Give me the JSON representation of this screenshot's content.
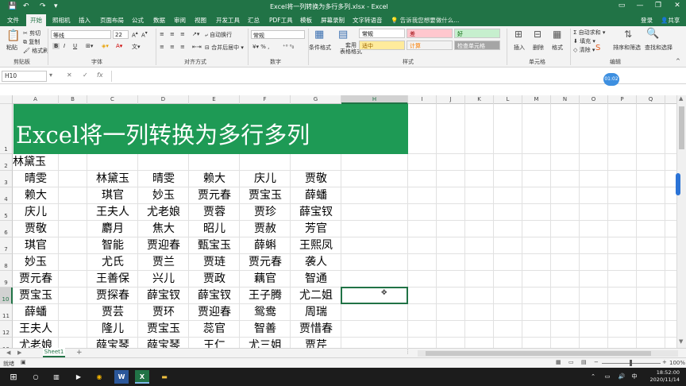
{
  "window": {
    "title": "Excel将一列转换为多行多列.xlsx  -  Excel"
  },
  "menu": {
    "tabs": [
      "文件",
      "开始",
      "照相机",
      "插入",
      "页面布局",
      "公式",
      "数据",
      "审阅",
      "视图",
      "开发工具",
      "汇总",
      "PDF工具",
      "模板",
      "屏幕录制",
      "文字转语音"
    ],
    "active_tab": "开始",
    "tell_me": "告诉我您想要做什么...",
    "login": "登录",
    "share": "共享"
  },
  "ribbon": {
    "clipboard": {
      "paste": "粘贴",
      "cut": "剪切",
      "copy": "复制",
      "format_painter": "格式刷",
      "label": "剪贴板"
    },
    "font": {
      "name": "等线",
      "size": "22",
      "bold": "B",
      "italic": "I",
      "underline": "U",
      "label": "字体"
    },
    "alignment": {
      "wrap": "自动换行",
      "merge": "合并后居中",
      "label": "对齐方式"
    },
    "number": {
      "format": "常规",
      "label": "数字"
    },
    "styles": {
      "conditional": "条件格式",
      "table": "套用\n表格格式",
      "cells": [
        {
          "name": "常规",
          "bg": "#ffffff",
          "fg": "#000000"
        },
        {
          "name": "差",
          "bg": "#ffc7ce",
          "fg": "#9c0006"
        },
        {
          "name": "好",
          "bg": "#c6efce",
          "fg": "#006100"
        },
        {
          "name": "适中",
          "bg": "#ffeb9c",
          "fg": "#9c6500"
        },
        {
          "name": "计算",
          "bg": "#f2f2f2",
          "fg": "#fa7d00"
        },
        {
          "name": "检查单元格",
          "bg": "#a5a5a5",
          "fg": "#ffffff"
        }
      ],
      "label": "样式"
    },
    "cells_group": {
      "insert": "插入",
      "delete": "删除",
      "format": "格式",
      "label": "单元格"
    },
    "editing": {
      "autosum": "自动求和",
      "fill": "填充",
      "clear": "清除",
      "sort": "排序和筛选",
      "find": "查找和选择",
      "label": "编辑"
    }
  },
  "formula_bar": {
    "name_box": "H10",
    "fx": "fx",
    "cancel": "✕",
    "enter": "✓"
  },
  "badge": "01:02",
  "grid": {
    "columns": [
      "A",
      "B",
      "C",
      "D",
      "E",
      "F",
      "G",
      "H",
      "I",
      "J",
      "K",
      "L",
      "M",
      "N",
      "O",
      "P",
      "Q"
    ],
    "rows": [
      "1",
      "2",
      "3",
      "4",
      "5",
      "6",
      "7",
      "8",
      "9",
      "10",
      "11",
      "12",
      "13"
    ],
    "banner": "Excel将一列转换为多行多列",
    "colA": [
      "林黛玉",
      "晴雯",
      "赖大",
      "庆儿",
      "贾敬",
      "琪官",
      "妙玉",
      "贾元春",
      "贾宝玉",
      "薛蟠",
      "王夫人",
      "尤老娘"
    ],
    "table": [
      [
        "林黛玉",
        "晴雯",
        "赖大",
        "庆儿",
        "贾敬"
      ],
      [
        "琪官",
        "妙玉",
        "贾元春",
        "贾宝玉",
        "薛蟠"
      ],
      [
        "王夫人",
        "尤老娘",
        "贾蓉",
        "贾珍",
        "薛宝钗"
      ],
      [
        "麝月",
        "焦大",
        "昭儿",
        "贾赦",
        "芳官"
      ],
      [
        "智能",
        "贾迎春",
        "甄宝玉",
        "薛蝌",
        "王熙凤"
      ],
      [
        "尤氏",
        "贾兰",
        "贾琏",
        "贾元春",
        "袭人"
      ],
      [
        "王善保",
        "兴儿",
        "贾政",
        "藕官",
        "智通"
      ],
      [
        "贾探春",
        "薛宝钗",
        "薛宝钗",
        "王子腾",
        "尤二姐"
      ],
      [
        "贾芸",
        "贾环",
        "贾迎春",
        "鸳鸯",
        "周瑞"
      ],
      [
        "隆儿",
        "贾宝玉",
        "蕊官",
        "智善",
        "贾惜春"
      ],
      [
        "薛宝琴",
        "薛宝琴",
        "王仁",
        "尤三姐",
        "贾芹"
      ]
    ]
  },
  "sheets": {
    "active": "Sheet1",
    "add": "+"
  },
  "status": {
    "ready": "就绪",
    "zoom": "100%"
  },
  "taskbar": {
    "time": "18:52:00",
    "date": "2020/11/14"
  }
}
